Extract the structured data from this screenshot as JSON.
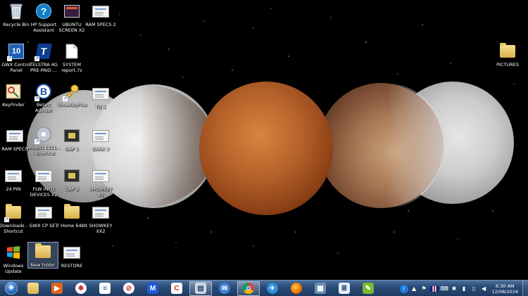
{
  "desktop_icons": {
    "recycle_bin": "Recycle Bin",
    "hp_support": "HP Support\nAssistant",
    "ubuntu": "UBUNTU\nSCREEN X2",
    "ram_specs2": "RAM SPECS 2",
    "gwx_control": "GWX Control\nPanel",
    "telstra": "TELSTRA 4G\nPRE-PAID ...",
    "system_report": "SYSTEM\nreport.7z",
    "pictures": "PICTURES",
    "keyfinder": "KeyFinder",
    "belarc": "Belarc\nAdvisor",
    "showkeyplus": "ShowKeyPlus",
    "tb1": "TB 1",
    "ram_specs": "RAM SPECS",
    "winaio": "WinAIO 1511...\n- Shortcut",
    "gap1": "GAP 1",
    "bank": "BANK X",
    "pin24": "24 PIN",
    "flw_info": "FLW INFO\nDEVICES X2",
    "gap2": "GAP 2",
    "showkey_x": "SHOWKEY\nX2",
    "downloads": "Downloads -\nShortcut",
    "gwx_cp_set": "GWX CP SET",
    "home64": "7 Home 64bit",
    "showkey_xx2": "SHOWKEY\nXX2",
    "windows_update": "Windows\nUpdate",
    "new_folder": "New folder",
    "restore": "RESTORE"
  },
  "taskbar": {
    "clock_time": "6:30 AM",
    "clock_date": "12/08/2016",
    "pinned": [
      "windows-explorer",
      "media-player",
      "wolfram",
      "word-document",
      "no-entry",
      "malwarebytes",
      "ccleaner",
      "file-manager",
      "thunderbird",
      "chrome",
      "network-globe",
      "firefox",
      "vmware",
      "notepad",
      "paint"
    ]
  },
  "colors": {
    "taskbar_top": "#4b6f9c",
    "taskbar_bottom": "#1e3a61",
    "blood_moon": "#b4612a",
    "wallpaper": "#000000"
  }
}
